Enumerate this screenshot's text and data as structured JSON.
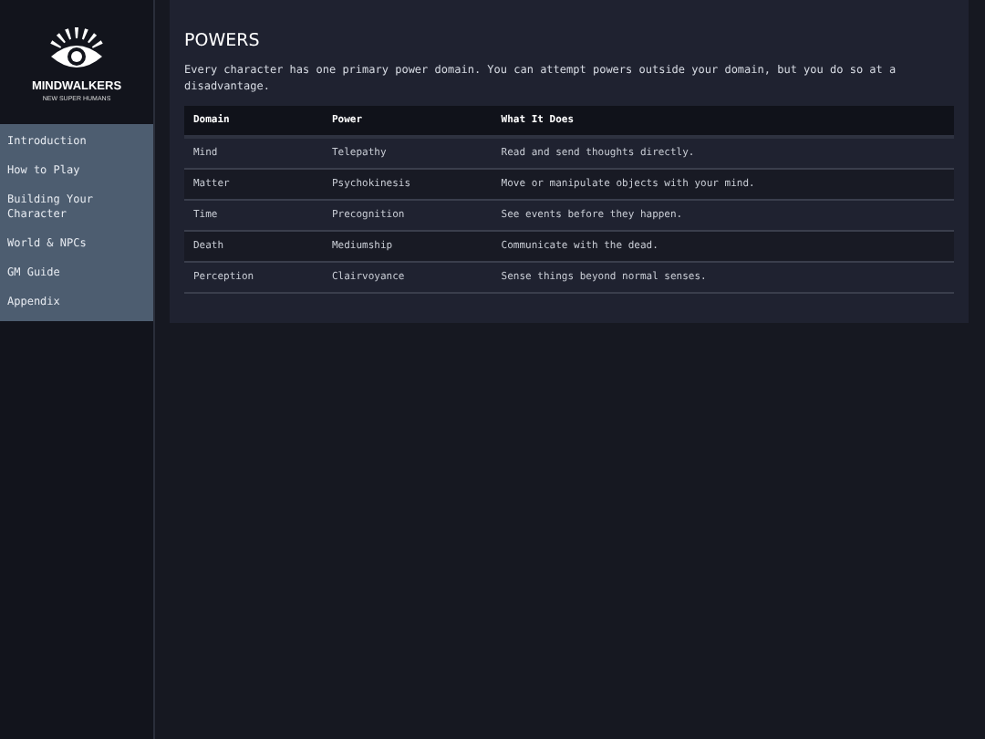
{
  "logo": {
    "title": "MINDWALKERS",
    "subtitle": "NEW SUPER HUMANS"
  },
  "sidebar": {
    "items": [
      {
        "label": "Introduction",
        "selected": false
      },
      {
        "label": "How to Play",
        "selected": false
      },
      {
        "label": "Building Your Character",
        "selected": false
      },
      {
        "label": "World & NPCs",
        "selected": false
      },
      {
        "label": "GM Guide",
        "selected": false
      },
      {
        "label": "Appendix",
        "selected": false
      }
    ]
  },
  "section": {
    "title": "POWERS",
    "intro": "Every character has one primary power domain. You can attempt powers outside your domain, but you do so at a disadvantage."
  },
  "table": {
    "columns": [
      "Domain",
      "Power",
      "What It Does"
    ],
    "rows": [
      [
        "Mind",
        "Telepathy",
        "Read and send thoughts directly."
      ],
      [
        "Matter",
        "Psychokinesis",
        "Move or manipulate objects with your mind."
      ],
      [
        "Time",
        "Precognition",
        "See events before they happen."
      ],
      [
        "Death",
        "Mediumship",
        "Communicate with the dead."
      ],
      [
        "Perception",
        "Clairvoyance",
        "Sense things beyond normal senses."
      ]
    ]
  }
}
